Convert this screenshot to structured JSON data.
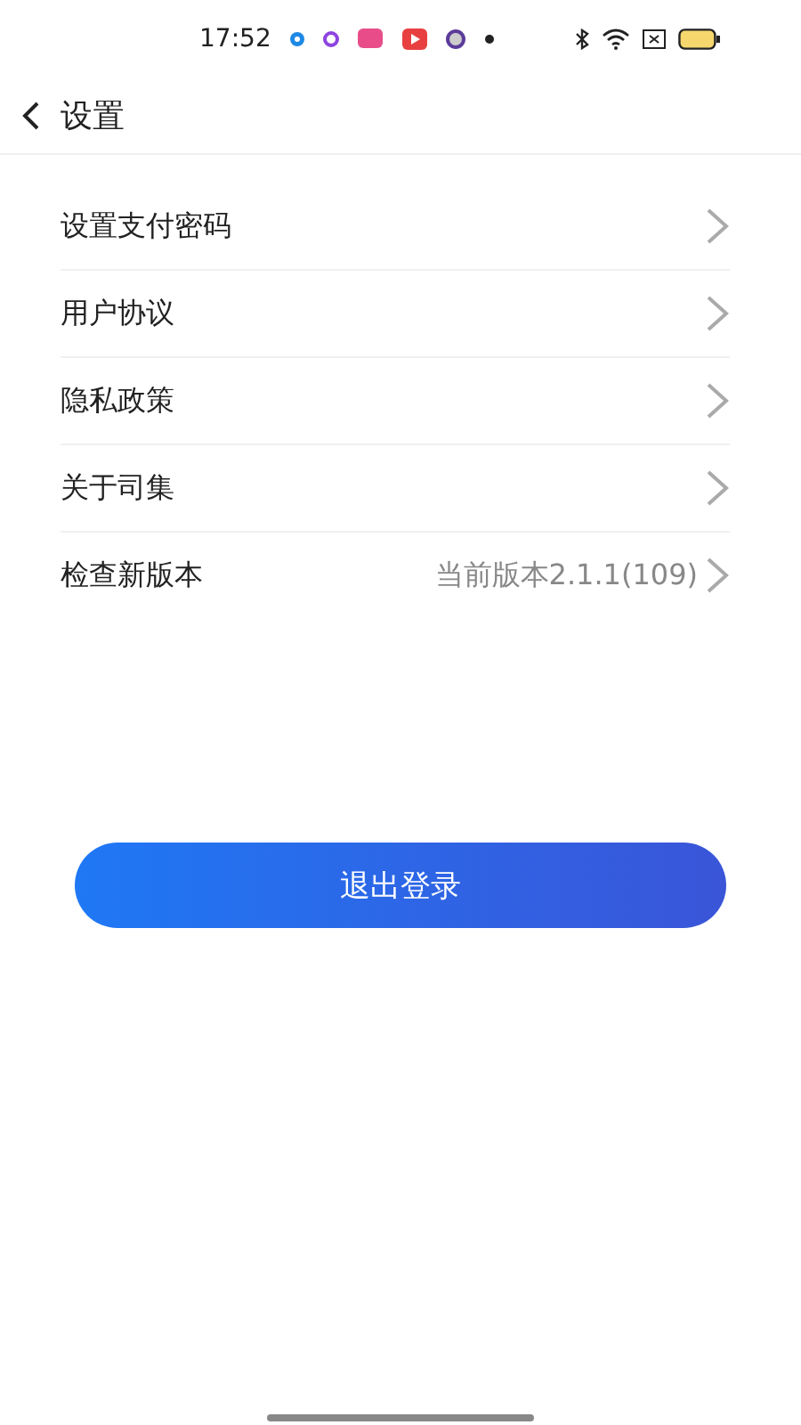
{
  "status_bar": {
    "time": "17:52"
  },
  "header": {
    "title": "设置"
  },
  "items": [
    {
      "label": "设置支付密码"
    },
    {
      "label": "用户协议"
    },
    {
      "label": "隐私政策"
    },
    {
      "label": "关于司集"
    },
    {
      "label": "检查新版本",
      "value": "当前版本2.1.1(109)"
    }
  ],
  "logout_button": "退出登录"
}
